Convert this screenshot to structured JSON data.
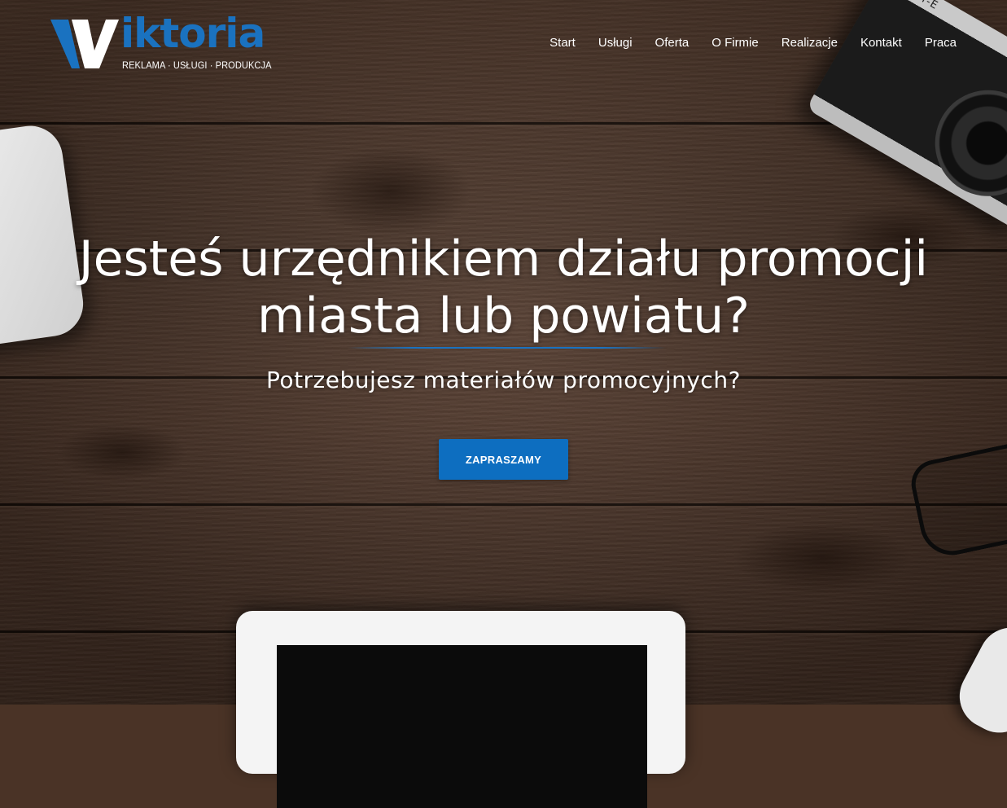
{
  "brand": {
    "name": "iktoria",
    "logo_letter": "V",
    "tagline": "REKLAMA · USŁUGI · PRODUKCJA",
    "accent_color": "#1a72c0"
  },
  "nav": {
    "items": [
      {
        "label": "Start"
      },
      {
        "label": "Usługi"
      },
      {
        "label": "Oferta"
      },
      {
        "label": "O Firmie"
      },
      {
        "label": "Realizacje"
      },
      {
        "label": "Kontakt"
      },
      {
        "label": "Praca"
      }
    ]
  },
  "hero": {
    "title_line1": "Jesteś urzędnikiem działu promocji",
    "title_line2": "miasta lub powiatu?",
    "subtitle": "Potrzebujesz materiałów promocyjnych?",
    "cta_label": "ZAPRASZAMY",
    "cta_color": "#0d6ec0"
  },
  "decor": {
    "camera_label": "ZENIT-E"
  }
}
